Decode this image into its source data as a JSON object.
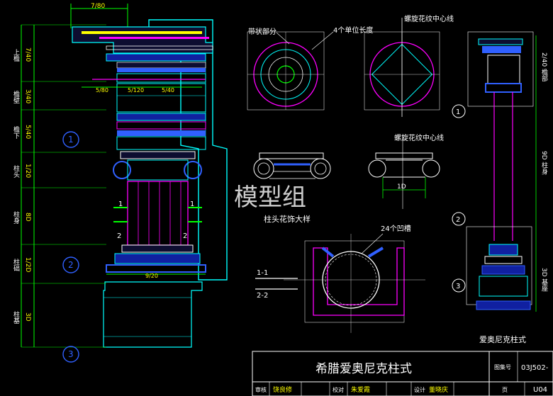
{
  "watermark": "模型组",
  "left_column": {
    "dims": {
      "top": "7/80",
      "d1": "5/80",
      "d2": "5/120",
      "d3": "5/40",
      "bottom": "9/20"
    },
    "cut_marks": [
      "1",
      "1",
      "2",
      "2"
    ],
    "zone_markers": [
      "1",
      "2",
      "3"
    ],
    "side_labels": [
      {
        "name": "上檐",
        "value": "7/40"
      },
      {
        "name": "檐壁",
        "value": "3/40"
      },
      {
        "name": "檐下",
        "value": "5/40"
      },
      {
        "name": "柱头",
        "value": "1/20"
      },
      {
        "name": "柱身",
        "value": "8D"
      },
      {
        "name": "柱础",
        "value": "1/2D"
      },
      {
        "name": "柱基",
        "value": "3D"
      }
    ]
  },
  "annotations": {
    "band": "带状部分",
    "unit_length": "4个单位长度",
    "spiral_center_top": "螺旋花纹中心线",
    "spiral_center_mid": "螺旋花纹中心线",
    "capital_detail": "柱头花饰大样",
    "dim_1d": "1D",
    "flutes": "24个凹槽",
    "section_1": "1-1",
    "section_2": "2-2"
  },
  "right_column": {
    "markers": [
      "1",
      "2",
      "3"
    ],
    "side_labels": [
      "2/40 檐部",
      "9D 柱身",
      "3D 基座"
    ],
    "caption": "爱奥尼克柱式"
  },
  "title_block": {
    "title": "希腊爱奥尼克柱式",
    "atlas_label": "图集号",
    "atlas_value": "03J502-",
    "row": [
      "审核",
      "饶良修",
      "校对",
      "朱爱霞",
      "设计",
      "董晓庆",
      "页",
      "U04"
    ]
  },
  "colors": {
    "bg": "#000000",
    "yellow": "#ffff00",
    "cyan": "#00ffff",
    "magenta": "#ff00ff",
    "green": "#00ff00",
    "white": "#ffffff",
    "blue": "#3060ff"
  }
}
